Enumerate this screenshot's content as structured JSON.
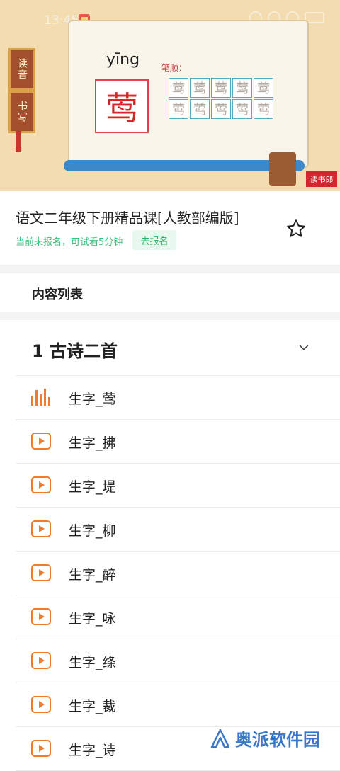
{
  "status_bar": {
    "time": "13:45"
  },
  "banner": {
    "side_tags": [
      "读音",
      "书写"
    ],
    "pinyin": "yīng",
    "character": "莺",
    "stroke_title": "笔顺：",
    "stroke_cells": [
      "莺",
      "莺",
      "莺",
      "莺",
      "莺",
      "莺",
      "莺",
      "莺",
      "莺",
      "莺"
    ],
    "logo": "读书郎"
  },
  "course": {
    "title": "语文二年级下册精品课[人教部编版]",
    "trial_text": "当前未报名，可试看5分钟",
    "enroll_label": "去报名"
  },
  "content_list": {
    "heading": "内容列表",
    "section_title": "1 古诗二首",
    "items": [
      {
        "label": "生字_莺",
        "icon": "playing-bars-icon"
      },
      {
        "label": "生字_拂",
        "icon": "play-icon"
      },
      {
        "label": "生字_堤",
        "icon": "play-icon"
      },
      {
        "label": "生字_柳",
        "icon": "play-icon"
      },
      {
        "label": "生字_醉",
        "icon": "play-icon"
      },
      {
        "label": "生字_咏",
        "icon": "play-icon"
      },
      {
        "label": "生字_绦",
        "icon": "play-icon"
      },
      {
        "label": "生字_裁",
        "icon": "play-icon"
      },
      {
        "label": "生字_诗",
        "icon": "play-icon"
      }
    ]
  },
  "watermark": {
    "text": "奥派软件园"
  },
  "colors": {
    "accent": "#f07b2e",
    "green": "#3cbf7a"
  }
}
